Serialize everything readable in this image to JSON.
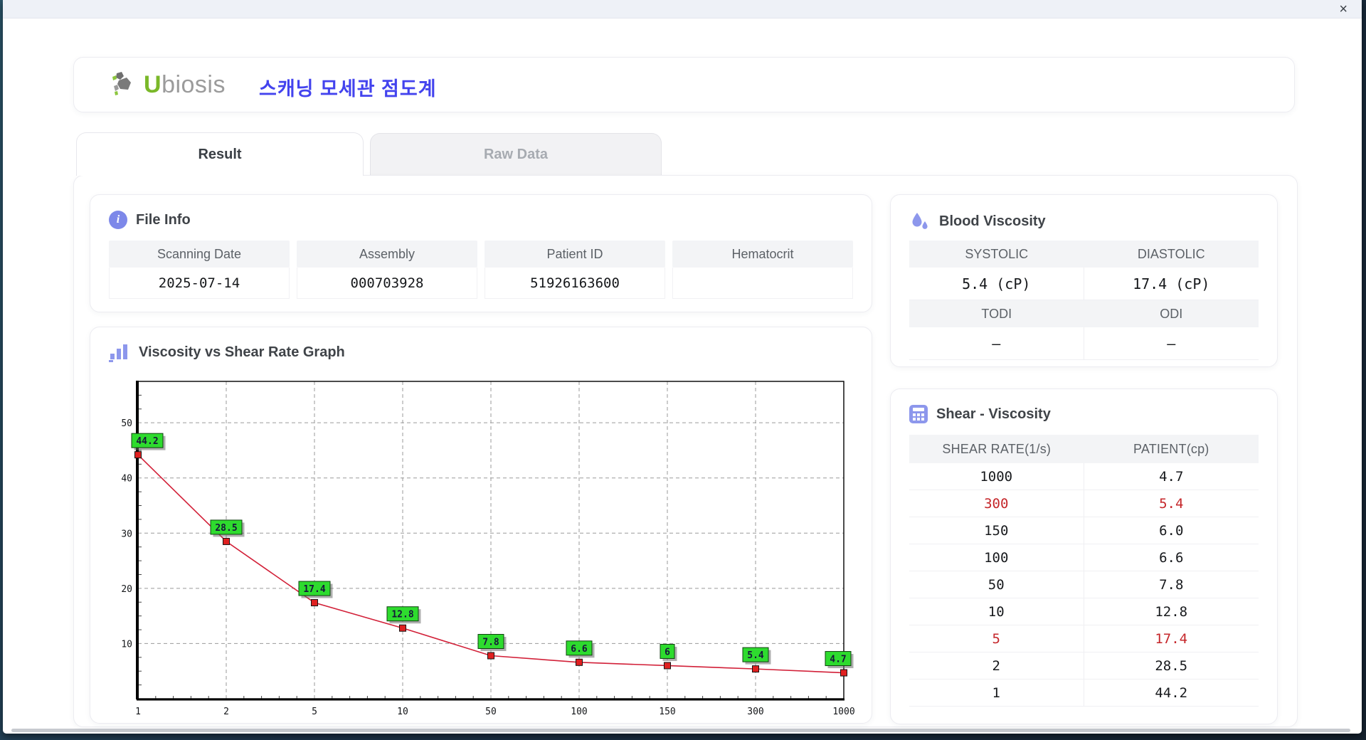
{
  "window": {
    "close_label": "×"
  },
  "header": {
    "brand_u": "U",
    "brand_rest": "biosis",
    "app_title": "스캐닝 모세관 점도계"
  },
  "tabs": [
    {
      "label": "Result",
      "active": true
    },
    {
      "label": "Raw Data",
      "active": false
    }
  ],
  "file_info": {
    "title": "File Info",
    "fields": [
      {
        "label": "Scanning Date",
        "value": "2025-07-14"
      },
      {
        "label": "Assembly",
        "value": "000703928"
      },
      {
        "label": "Patient ID",
        "value": "51926163600"
      },
      {
        "label": "Hematocrit",
        "value": ""
      }
    ]
  },
  "blood_viscosity": {
    "title": "Blood Viscosity",
    "rows": [
      {
        "labels": [
          "SYSTOLIC",
          "DIASTOLIC"
        ],
        "values": [
          "5.4 (cP)",
          "17.4 (cP)"
        ]
      },
      {
        "labels": [
          "TODI",
          "ODI"
        ],
        "values": [
          "–",
          "–"
        ]
      }
    ]
  },
  "shear_table": {
    "title": "Shear - Viscosity",
    "columns": [
      "SHEAR RATE(1/s)",
      "PATIENT(cp)"
    ],
    "rows": [
      {
        "shear": "1000",
        "patient": "4.7",
        "highlight": false
      },
      {
        "shear": "300",
        "patient": "5.4",
        "highlight": true
      },
      {
        "shear": "150",
        "patient": "6.0",
        "highlight": false
      },
      {
        "shear": "100",
        "patient": "6.6",
        "highlight": false
      },
      {
        "shear": "50",
        "patient": "7.8",
        "highlight": false
      },
      {
        "shear": "10",
        "patient": "12.8",
        "highlight": false
      },
      {
        "shear": "5",
        "patient": "17.4",
        "highlight": true
      },
      {
        "shear": "2",
        "patient": "28.5",
        "highlight": false
      },
      {
        "shear": "1",
        "patient": "44.2",
        "highlight": false
      }
    ]
  },
  "graph": {
    "title": "Viscosity vs Shear Rate Graph"
  },
  "chart_data": {
    "type": "line",
    "title": "Viscosity vs Shear Rate Graph",
    "x": [
      "1",
      "2",
      "5",
      "10",
      "50",
      "100",
      "150",
      "300",
      "1000"
    ],
    "values": [
      44.2,
      28.5,
      17.4,
      12.8,
      7.8,
      6.6,
      6,
      5.4,
      4.7
    ],
    "point_labels": [
      "44.2",
      "28.5",
      "17.4",
      "12.8",
      "7.8",
      "6.6",
      "6",
      "5.4",
      "4.7"
    ],
    "xlabel": "",
    "ylabel": "",
    "yticks": [
      10,
      20,
      30,
      40,
      50
    ],
    "ylim": [
      0,
      57.5
    ],
    "grid": true,
    "legend": "none",
    "line_color": "#d22038",
    "marker_color": "#e02020",
    "marker_border": "#141414",
    "label_bg": "#2edb2e",
    "label_border": "#104010",
    "label_text_color": "#16163a",
    "grid_color": "#9a9a9a",
    "axis_color": "#000000"
  },
  "colors": {
    "accent_purple": "#8d97ec",
    "brand_green": "#7ab829",
    "title_blue": "#4343ee",
    "highlight_red": "#c5262a",
    "header_gray_bg": "#f3f4f6"
  }
}
